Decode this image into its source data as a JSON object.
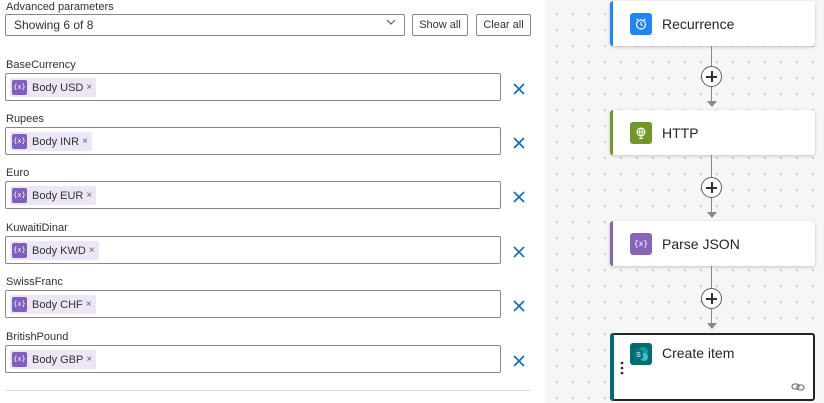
{
  "advanced": {
    "label": "Advanced parameters",
    "select_value": "Showing 6 of 8",
    "show_all": "Show all",
    "clear_all": "Clear all"
  },
  "fields": [
    {
      "label": "BaseCurrency",
      "token": "Body USD"
    },
    {
      "label": "Rupees",
      "token": "Body INR"
    },
    {
      "label": "Euro",
      "token": "Body EUR"
    },
    {
      "label": "KuwaitiDinar",
      "token": "Body KWD"
    },
    {
      "label": "SwissFranc",
      "token": "Body CHF"
    },
    {
      "label": "BritishPound",
      "token": "Body GBP"
    }
  ],
  "token_icon_glyph": "{x}",
  "token_remove": "×",
  "flow": {
    "nodes": [
      {
        "title": "Recurrence",
        "icon": "alarm-clock-icon",
        "color": "#1f85ff"
      },
      {
        "title": "HTTP",
        "icon": "globe-icon",
        "color": "#709727"
      },
      {
        "title": "Parse JSON",
        "icon": "variable-icon",
        "color": "#8764b8"
      },
      {
        "title": "Create item",
        "icon": "sharepoint-icon",
        "color": "#036c70"
      }
    ]
  },
  "colors": {
    "accent_blue": "#1f85ff",
    "delete_x": "#0f6cbd",
    "token_bg": "#ede6f6",
    "token_icon": "#7f5fbf"
  }
}
